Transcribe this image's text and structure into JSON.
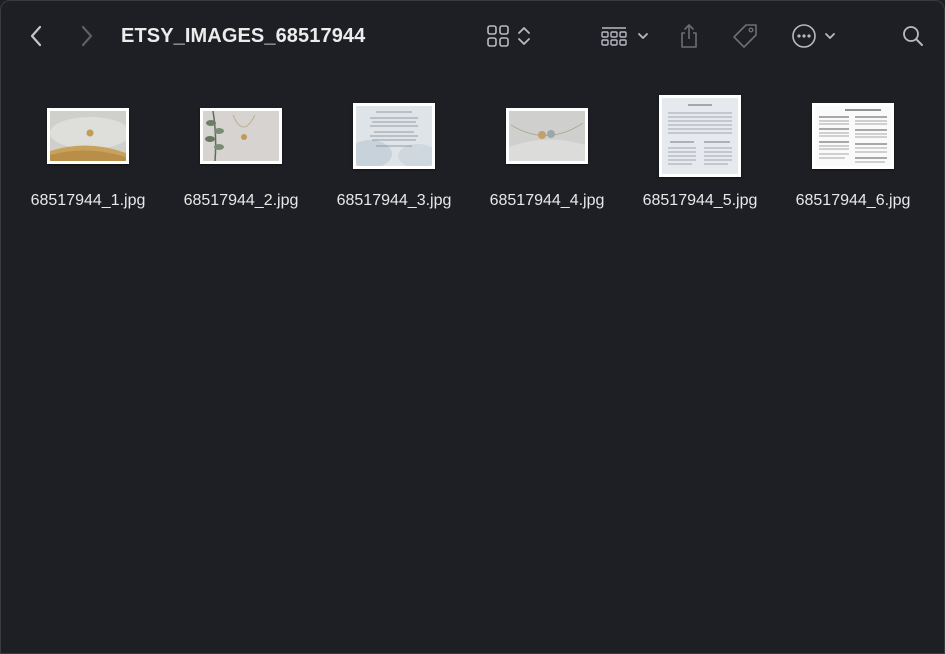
{
  "window": {
    "title": "ETSY_IMAGES_68517944"
  },
  "toolbar": {
    "back": "chevron-left-icon",
    "forward": "chevron-right-icon",
    "view": "icon-grid-icon",
    "group": "group-by-icon",
    "share": "share-icon",
    "tags": "tag-icon",
    "more": "ellipsis-circle-icon",
    "search": "search-icon"
  },
  "files": [
    {
      "name": "68517944_1.jpg"
    },
    {
      "name": "68517944_2.jpg"
    },
    {
      "name": "68517944_3.jpg"
    },
    {
      "name": "68517944_4.jpg"
    },
    {
      "name": "68517944_5.jpg"
    },
    {
      "name": "68517944_6.jpg"
    }
  ],
  "colors": {
    "background": "#1e1f24",
    "text": "#e8e8e8",
    "icon": "#b9bac0",
    "icon_dim": "#6d6e74"
  }
}
